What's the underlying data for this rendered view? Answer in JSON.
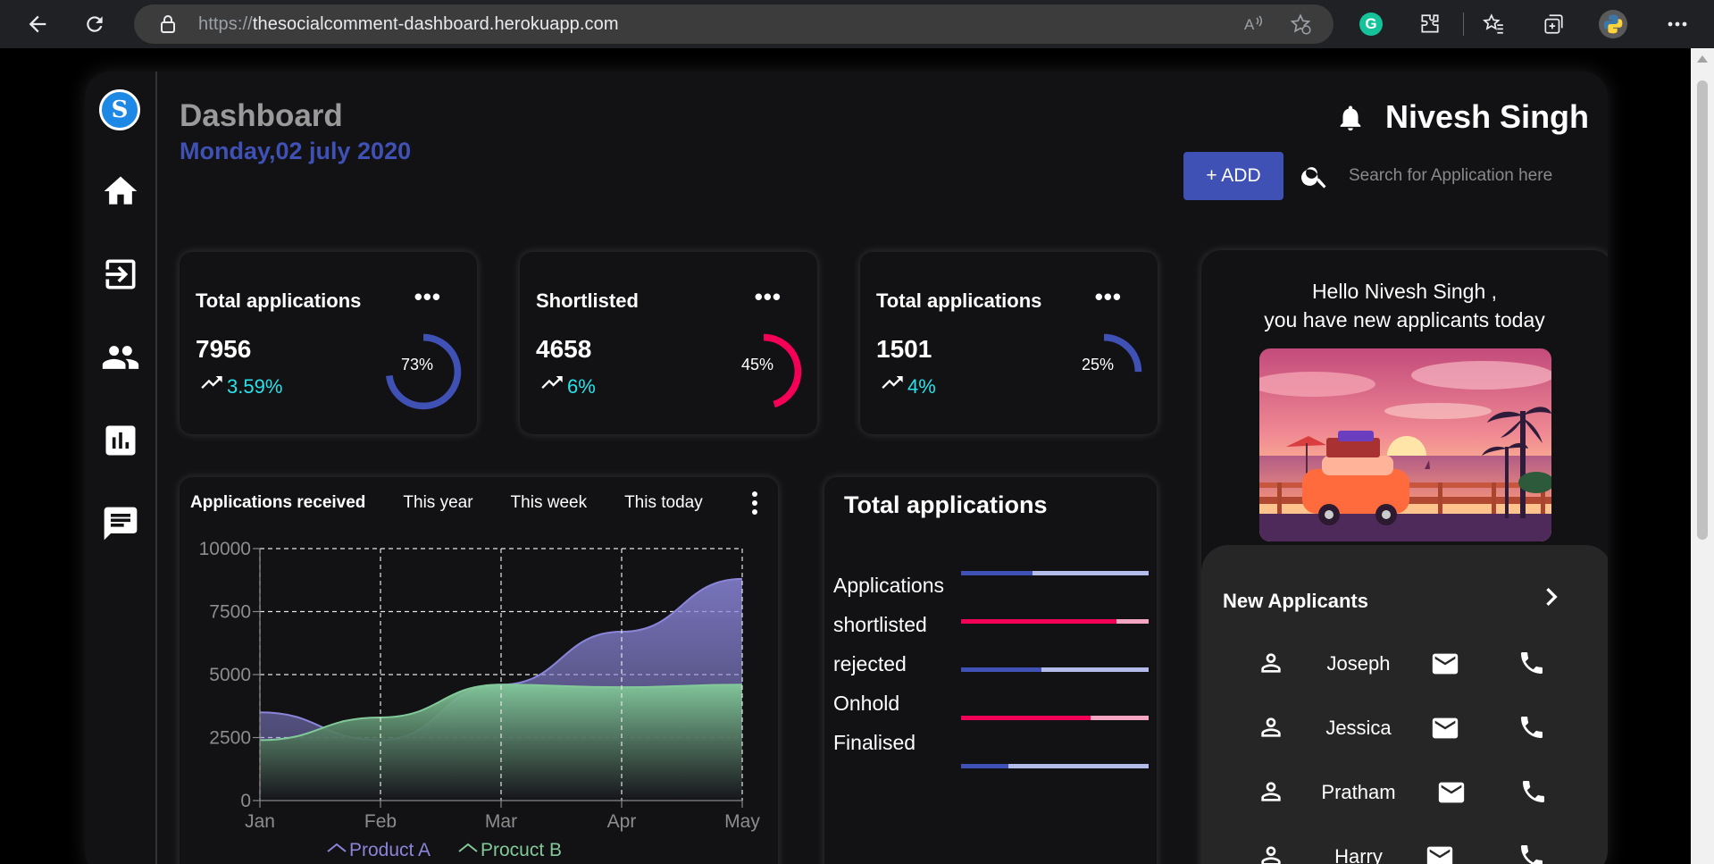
{
  "browser": {
    "url_protocol": "https://",
    "url_host": "thesocialcomment-dashboard.herokuapp.com"
  },
  "sidebar": {
    "logo_letter": "S",
    "items": [
      "home-icon",
      "login-icon",
      "people-icon",
      "chart-icon",
      "chat-icon"
    ]
  },
  "header": {
    "title": "Dashboard",
    "date": "Monday,02 july 2020",
    "user_name": "Nivesh Singh",
    "add_label": "+ ADD",
    "search_placeholder": "Search for Application here"
  },
  "stats": [
    {
      "title": "Total applications",
      "value": "7956",
      "change": "3.59%",
      "percent": 73,
      "percent_label": "73%",
      "color": "#3f51b5"
    },
    {
      "title": "Shortlisted",
      "value": "4658",
      "change": "6%",
      "percent": 45,
      "percent_label": "45%",
      "color": "#f50057"
    },
    {
      "title": "Total applications",
      "value": "1501",
      "change": "4%",
      "percent": 25,
      "percent_label": "25%",
      "color": "#3f51b5"
    }
  ],
  "stat_menu_icon": "•••",
  "received_chart": {
    "title": "Applications received",
    "tabs": [
      "This year",
      "This week",
      "This today"
    ]
  },
  "chart_data": {
    "type": "area",
    "categories": [
      "Jan",
      "Feb",
      "Mar",
      "Apr",
      "May"
    ],
    "ylim": [
      0,
      10000
    ],
    "yticks": [
      "0",
      "2500",
      "5000",
      "7500",
      "10000"
    ],
    "grid": true,
    "legend_position": "bottom",
    "colors": {
      "series_a": "#8a85d9",
      "series_b": "#82c99a"
    },
    "series": [
      {
        "name": "Product A",
        "values": [
          3500,
          2400,
          4600,
          6700,
          8800
        ]
      },
      {
        "name": "Procuct B",
        "values": [
          2400,
          3300,
          4600,
          4500,
          4600
        ]
      }
    ]
  },
  "totals": {
    "title": "Total applications",
    "rows": [
      {
        "label": "Applications",
        "value": 0.38,
        "color": "#3f51b5"
      },
      {
        "label": "shortlisted",
        "value": 0.83,
        "color": "#f50057"
      },
      {
        "label": "rejected",
        "value": 0.43,
        "color": "#3f51b5"
      },
      {
        "label": "Onhold",
        "value": 0.69,
        "color": "#f50057"
      },
      {
        "label": "Finalised",
        "value": 0.25,
        "color": "#3f51b5"
      }
    ]
  },
  "welcome": {
    "line1": "Hello Nivesh Singh ,",
    "line2": "you have new applicants today"
  },
  "applicants": {
    "title": "New Applicants",
    "list": [
      "Joseph",
      "Jessica",
      "Pratham",
      "Harry"
    ]
  }
}
